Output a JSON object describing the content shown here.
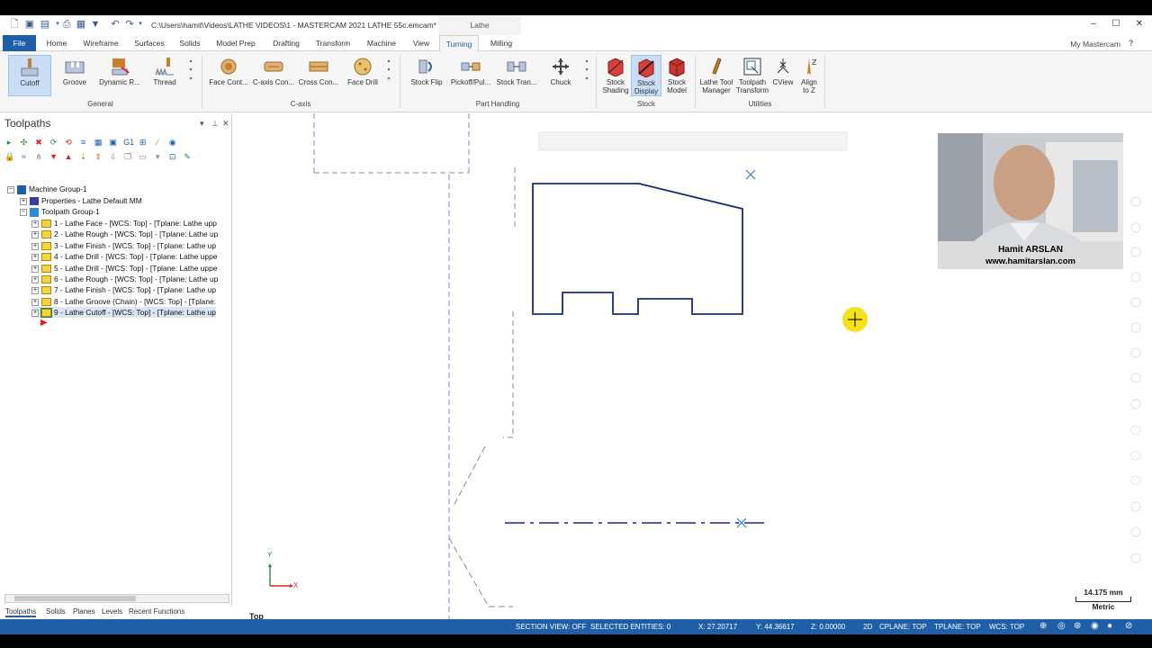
{
  "window": {
    "title": "C:\\Users\\hamit\\Videos\\LATHE VIDEOS\\1 - MASTERCAM 2021 LATHE 55c.emcam* - Masterc...",
    "context_tab": "Lathe"
  },
  "tabs": [
    "File",
    "Home",
    "Wireframe",
    "Surfaces",
    "Solids",
    "Model Prep",
    "Drafting",
    "Transform",
    "Machine",
    "View",
    "Turning",
    "Milling"
  ],
  "active_tab": "Turning",
  "my_mastercam": "My Mastercam",
  "ribbon": {
    "general": {
      "label": "General",
      "buttons": [
        "Cutoff",
        "Groove",
        "Dynamic R...",
        "Thread"
      ]
    },
    "caxis": {
      "label": "C-axis",
      "buttons": [
        "Face Cont...",
        "C-axis Con...",
        "Cross Con...",
        "Face Drill"
      ]
    },
    "part_handling": {
      "label": "Part Handling",
      "buttons": [
        "Stock Flip",
        "Pickoff/Pul...",
        "Stock Tran...",
        "Chuck"
      ]
    },
    "stock": {
      "label": "Stock",
      "buttons": [
        {
          "line1": "Stock",
          "line2": "Shading"
        },
        {
          "line1": "Stock",
          "line2": "Display"
        },
        {
          "line1": "Stock",
          "line2": "Model"
        }
      ]
    },
    "utilities": {
      "label": "Utilities",
      "buttons": [
        {
          "line1": "Lathe Tool",
          "line2": "Manager"
        },
        {
          "line1": "Toolpath",
          "line2": "Transform"
        },
        {
          "line1": "CView",
          "line2": ""
        },
        {
          "line1": "Align",
          "line2": "to Z"
        }
      ]
    }
  },
  "panel": {
    "title": "Toolpaths",
    "tree": {
      "machine_group": "Machine Group-1",
      "properties": "Properties - Lathe Default MM",
      "toolpath_group": "Toolpath Group-1",
      "ops": [
        "1 - Lathe Face - [WCS: Top] - [Tplane: Lathe upp",
        "2 - Lathe Rough - [WCS: Top] - [Tplane: Lathe up",
        "3 - Lathe Finish - [WCS: Top] - [Tplane: Lathe up",
        "4 - Lathe Drill - [WCS: Top] - [Tplane: Lathe uppe",
        "5 - Lathe Drill - [WCS: Top] - [Tplane: Lathe uppe",
        "6 - Lathe Rough - [WCS: Top] - [Tplane: Lathe up",
        "7 - Lathe Finish - [WCS: Top] - [Tplane: Lathe up",
        "8 - Lathe Groove (Chain) - [WCS: Top] - [Tplane:",
        "9 - Lathe Cutoff - [WCS: Top] - [Tplane: Lathe up"
      ]
    },
    "bottom_tabs": [
      "Toolpaths",
      "Solids",
      "Planes",
      "Levels",
      "Recent Functions"
    ]
  },
  "graphics": {
    "view_label": "Top",
    "axis_y": "Y",
    "axis_x": "X",
    "scale_value": "14.175 mm",
    "scale_unit": "Metric"
  },
  "webcam": {
    "name": "Hamit ARSLAN",
    "url": "www.hamitarslan.com"
  },
  "status": {
    "section_view": "SECTION VIEW: OFF",
    "selected": "SELECTED ENTITIES: 0",
    "x": "X:  27.20717",
    "y": "Y:  44.36617",
    "z": "Z:  0.00000",
    "mode": "2D",
    "cplane": "CPLANE: TOP",
    "tplane": "TPLANE: TOP",
    "wcs": "WCS: TOP"
  },
  "colors": {
    "accent": "#1f5fa8",
    "geometry": "#1a2a7a",
    "cursor_highlight": "#f5e21a"
  }
}
